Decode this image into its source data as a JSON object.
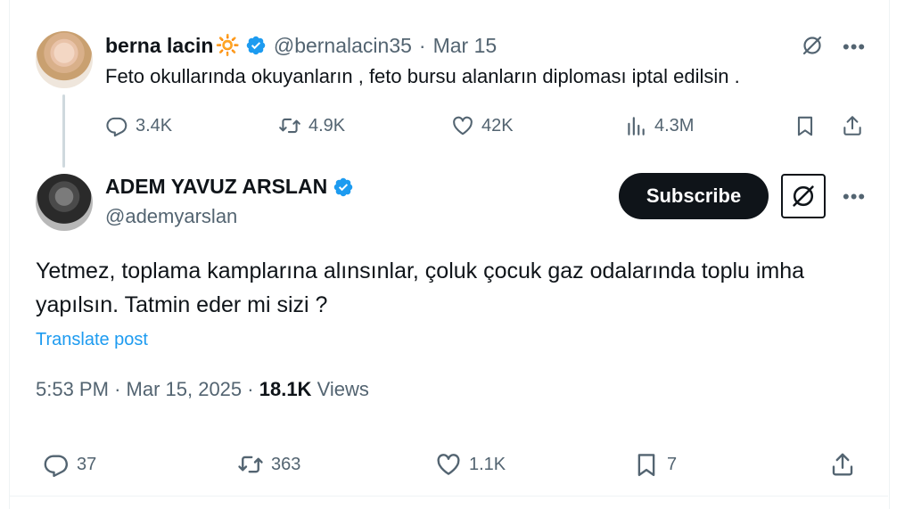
{
  "parent_tweet": {
    "name": "berna lacin",
    "handle": "@bernalacin35",
    "separator": "·",
    "date": "Mar 15",
    "text": "Feto okullarında okuyanların , feto bursu alanların diploması iptal edilsin .",
    "counts": {
      "replies": "3.4K",
      "reposts": "4.9K",
      "likes": "42K",
      "views": "4.3M"
    }
  },
  "main_tweet": {
    "name": "ADEM YAVUZ ARSLAN",
    "handle": "@ademyarslan",
    "subscribe_label": "Subscribe",
    "text": "Yetmez, toplama kamplarına alınsınlar, çoluk çocuk gaz odalarında toplu imha yapılsın. Tatmin eder mi sizi ?",
    "translate_label": "Translate post",
    "time": "5:53 PM",
    "sep": "·",
    "date": "Mar 15, 2025",
    "views_count": "18.1K",
    "views_label": "Views",
    "counts": {
      "replies": "37",
      "reposts": "363",
      "likes": "1.1K",
      "bookmarks": "7"
    }
  },
  "colors": {
    "accent": "#1d9bf0",
    "text_secondary": "#536471",
    "text_primary": "#0f1419"
  },
  "icons": [
    "verified-badge-icon",
    "sun-emoji-icon",
    "grok-icon",
    "more-icon",
    "reply-icon",
    "repost-icon",
    "like-icon",
    "views-icon",
    "bookmark-icon",
    "share-icon"
  ]
}
